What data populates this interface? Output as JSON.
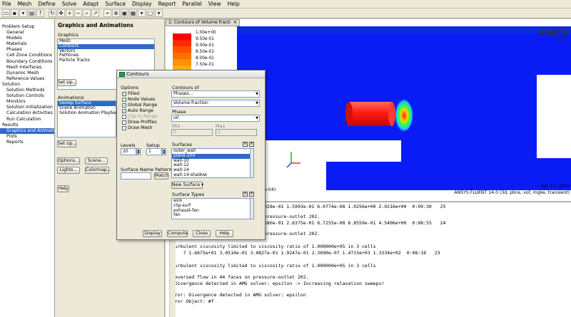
{
  "menu": [
    "File",
    "Mesh",
    "Define",
    "Solve",
    "Adapt",
    "Surface",
    "Display",
    "Report",
    "Parallel",
    "View",
    "Help"
  ],
  "nav": [
    {
      "label": "Problem Setup",
      "level": 0,
      "selected": false
    },
    {
      "label": "General",
      "level": 1,
      "selected": false
    },
    {
      "label": "Models",
      "level": 1,
      "selected": false
    },
    {
      "label": "Materials",
      "level": 1,
      "selected": false
    },
    {
      "label": "Phases",
      "level": 1,
      "selected": false
    },
    {
      "label": "Cell Zone Conditions",
      "level": 1,
      "selected": false
    },
    {
      "label": "Boundary Conditions",
      "level": 1,
      "selected": false
    },
    {
      "label": "Mesh Interfaces",
      "level": 1,
      "selected": false
    },
    {
      "label": "Dynamic Mesh",
      "level": 1,
      "selected": false
    },
    {
      "label": "Reference Values",
      "level": 1,
      "selected": false
    },
    {
      "label": "Solution",
      "level": 0,
      "selected": false
    },
    {
      "label": "Solution Methods",
      "level": 1,
      "selected": false
    },
    {
      "label": "Solution Controls",
      "level": 1,
      "selected": false
    },
    {
      "label": "Monitors",
      "level": 1,
      "selected": false
    },
    {
      "label": "Solution Initialization",
      "level": 1,
      "selected": false
    },
    {
      "label": "Calculation Activities",
      "level": 1,
      "selected": false
    },
    {
      "label": "Run Calculation",
      "level": 1,
      "selected": false
    },
    {
      "label": "Results",
      "level": 0,
      "selected": false
    },
    {
      "label": "Graphics and Animations",
      "level": 1,
      "selected": true
    },
    {
      "label": "Plots",
      "level": 1,
      "selected": false
    },
    {
      "label": "Reports",
      "level": 1,
      "selected": false
    }
  ],
  "panel": {
    "title": "Graphics and Animations",
    "graphics_label": "Graphics",
    "graphics_items": [
      "Mesh",
      "Contours",
      "Vectors",
      "Pathlines",
      "Particle Tracks"
    ],
    "graphics_selected": 1,
    "setup1": "Set Up...",
    "animations_label": "Animations",
    "animation_items": [
      "Sweep Surface",
      "Scene Animation",
      "Solution Animation Playback"
    ],
    "animation_selected": 0,
    "setup2": "Set Up...",
    "options_btn": "Options...",
    "scene_btn": "Scene...",
    "lights_btn": "Lights...",
    "colormap_btn": "Colormap...",
    "help_btn": "Help"
  },
  "graphics_window": {
    "tab": "1: Contours of Volume fracti",
    "legend_labels": [
      "1.00e+00",
      "9.50e-01",
      "9.00e-01",
      "8.50e-01",
      "8.00e-01",
      "7.50e-01"
    ],
    "brand": "ANSYS",
    "brand_version": "14.0",
    "title_fragment": "00e-04)",
    "date": "Apr 17, 2015",
    "info": "ANSYS FLUENT 14.0 (3d, pbns, vof, mgke, transient)"
  },
  "console_lines": [
    {
      "text": "028e-01 1.5903e-01 6.0774e-08 1.0256e+00 2.0216e+00  0:09:30   25",
      "frag": true
    },
    {
      "text": "pressure-outlet 202.",
      "frag": true
    },
    {
      "text": "580e-01 2.6375e-01 6.7255e-08 8.8559e-01 4.5406e+00  0:08:55   24",
      "frag": true
    },
    {
      "text": "pressure-outlet 202.",
      "frag": true
    },
    {
      "text": " turbulent viscosity limited to viscosity ratio of 1.000000e+05 in 3 cells",
      "frag": false
    },
    {
      "text": "     7 1.6675e+01 3.0510e-01 3.0827e-01 1.9247e-01 2.3690e-07 1.4715e+03 1.3334e+02  0:08:18   23",
      "frag": false
    },
    {
      "text": " turbulent viscosity limited to viscosity ratio of 1.000000e+05 in 3 cells",
      "frag": false
    },
    {
      "text": " reversed flow in 44 faces on pressure-outlet 202.",
      "frag": false
    },
    {
      "text": "# Divergence detected in AMG solver: epsilon -> Increasing relaxation sweeps!",
      "frag": false
    },
    {
      "text": "Error: Divergence detected in AMG solver: epsilon",
      "frag": false
    },
    {
      "text": "Error Object: #f",
      "frag": false
    }
  ],
  "dialog": {
    "title": "Contours",
    "options_label": "Options",
    "options": [
      {
        "label": "Filled",
        "checked": true,
        "disabled": false
      },
      {
        "label": "Node Values",
        "checked": true,
        "disabled": false
      },
      {
        "label": "Global Range",
        "checked": true,
        "disabled": false
      },
      {
        "label": "Auto Range",
        "checked": true,
        "disabled": false
      },
      {
        "label": "Clip to Range",
        "checked": false,
        "disabled": true
      },
      {
        "label": "Draw Profiles",
        "checked": false,
        "disabled": false
      },
      {
        "label": "Draw Mesh",
        "checked": false,
        "disabled": false
      }
    ],
    "contours_of_label": "Contours of",
    "contours_of": "Phases...",
    "contours_of2": "Volume fraction",
    "phase_label": "Phase",
    "phase": "oil",
    "min_label": "Min",
    "max_label": "Max",
    "min_value": "0",
    "max_value": "1",
    "levels_label": "Levels",
    "levels": "20",
    "setup_label": "Setup",
    "setup": "1",
    "surfaces_label": "Surfaces",
    "surfaces": [
      "outer_wall",
      "plane-200",
      "wall-10",
      "wall-12",
      "wall-14",
      "wall-14-shadow"
    ],
    "surfaces_selected": 1,
    "surface_name_pattern_label": "Surface Name Pattern",
    "match_btn": "Match",
    "new_surface_btn": "New Surface",
    "surface_types_label": "Surface Types",
    "surface_types": [
      "axis",
      "clip-surf",
      "exhaust-fan",
      "fan"
    ],
    "display_btn": "Display",
    "compute_btn": "Compute",
    "close_btn": "Close",
    "help_btn": "Help"
  },
  "colors": {
    "domain_blue": "#0a1cf5",
    "contour_red": "#ff1a12",
    "selection": "#316ac5"
  }
}
